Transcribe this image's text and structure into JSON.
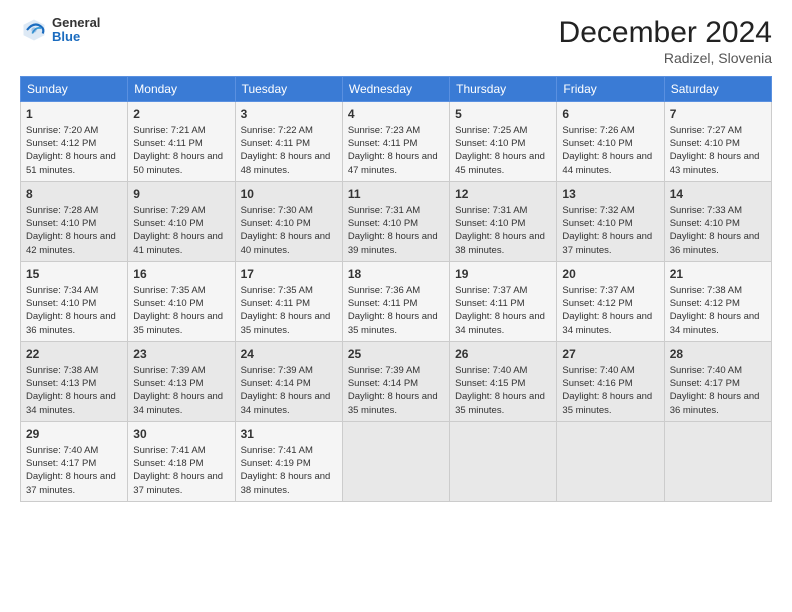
{
  "header": {
    "logo_general": "General",
    "logo_blue": "Blue",
    "title": "December 2024",
    "location": "Radizel, Slovenia"
  },
  "calendar": {
    "days_of_week": [
      "Sunday",
      "Monday",
      "Tuesday",
      "Wednesday",
      "Thursday",
      "Friday",
      "Saturday"
    ],
    "weeks": [
      [
        {
          "day": "",
          "empty": true
        },
        {
          "day": "",
          "empty": true
        },
        {
          "day": "",
          "empty": true
        },
        {
          "day": "",
          "empty": true
        },
        {
          "day": "",
          "empty": true
        },
        {
          "day": "",
          "empty": true
        },
        {
          "day": "",
          "empty": true
        }
      ],
      [
        {
          "day": "1",
          "sunrise": "Sunrise: 7:20 AM",
          "sunset": "Sunset: 4:12 PM",
          "daylight": "Daylight: 8 hours and 51 minutes."
        },
        {
          "day": "2",
          "sunrise": "Sunrise: 7:21 AM",
          "sunset": "Sunset: 4:11 PM",
          "daylight": "Daylight: 8 hours and 50 minutes."
        },
        {
          "day": "3",
          "sunrise": "Sunrise: 7:22 AM",
          "sunset": "Sunset: 4:11 PM",
          "daylight": "Daylight: 8 hours and 48 minutes."
        },
        {
          "day": "4",
          "sunrise": "Sunrise: 7:23 AM",
          "sunset": "Sunset: 4:11 PM",
          "daylight": "Daylight: 8 hours and 47 minutes."
        },
        {
          "day": "5",
          "sunrise": "Sunrise: 7:25 AM",
          "sunset": "Sunset: 4:10 PM",
          "daylight": "Daylight: 8 hours and 45 minutes."
        },
        {
          "day": "6",
          "sunrise": "Sunrise: 7:26 AM",
          "sunset": "Sunset: 4:10 PM",
          "daylight": "Daylight: 8 hours and 44 minutes."
        },
        {
          "day": "7",
          "sunrise": "Sunrise: 7:27 AM",
          "sunset": "Sunset: 4:10 PM",
          "daylight": "Daylight: 8 hours and 43 minutes."
        }
      ],
      [
        {
          "day": "8",
          "sunrise": "Sunrise: 7:28 AM",
          "sunset": "Sunset: 4:10 PM",
          "daylight": "Daylight: 8 hours and 42 minutes."
        },
        {
          "day": "9",
          "sunrise": "Sunrise: 7:29 AM",
          "sunset": "Sunset: 4:10 PM",
          "daylight": "Daylight: 8 hours and 41 minutes."
        },
        {
          "day": "10",
          "sunrise": "Sunrise: 7:30 AM",
          "sunset": "Sunset: 4:10 PM",
          "daylight": "Daylight: 8 hours and 40 minutes."
        },
        {
          "day": "11",
          "sunrise": "Sunrise: 7:31 AM",
          "sunset": "Sunset: 4:10 PM",
          "daylight": "Daylight: 8 hours and 39 minutes."
        },
        {
          "day": "12",
          "sunrise": "Sunrise: 7:31 AM",
          "sunset": "Sunset: 4:10 PM",
          "daylight": "Daylight: 8 hours and 38 minutes."
        },
        {
          "day": "13",
          "sunrise": "Sunrise: 7:32 AM",
          "sunset": "Sunset: 4:10 PM",
          "daylight": "Daylight: 8 hours and 37 minutes."
        },
        {
          "day": "14",
          "sunrise": "Sunrise: 7:33 AM",
          "sunset": "Sunset: 4:10 PM",
          "daylight": "Daylight: 8 hours and 36 minutes."
        }
      ],
      [
        {
          "day": "15",
          "sunrise": "Sunrise: 7:34 AM",
          "sunset": "Sunset: 4:10 PM",
          "daylight": "Daylight: 8 hours and 36 minutes."
        },
        {
          "day": "16",
          "sunrise": "Sunrise: 7:35 AM",
          "sunset": "Sunset: 4:10 PM",
          "daylight": "Daylight: 8 hours and 35 minutes."
        },
        {
          "day": "17",
          "sunrise": "Sunrise: 7:35 AM",
          "sunset": "Sunset: 4:11 PM",
          "daylight": "Daylight: 8 hours and 35 minutes."
        },
        {
          "day": "18",
          "sunrise": "Sunrise: 7:36 AM",
          "sunset": "Sunset: 4:11 PM",
          "daylight": "Daylight: 8 hours and 35 minutes."
        },
        {
          "day": "19",
          "sunrise": "Sunrise: 7:37 AM",
          "sunset": "Sunset: 4:11 PM",
          "daylight": "Daylight: 8 hours and 34 minutes."
        },
        {
          "day": "20",
          "sunrise": "Sunrise: 7:37 AM",
          "sunset": "Sunset: 4:12 PM",
          "daylight": "Daylight: 8 hours and 34 minutes."
        },
        {
          "day": "21",
          "sunrise": "Sunrise: 7:38 AM",
          "sunset": "Sunset: 4:12 PM",
          "daylight": "Daylight: 8 hours and 34 minutes."
        }
      ],
      [
        {
          "day": "22",
          "sunrise": "Sunrise: 7:38 AM",
          "sunset": "Sunset: 4:13 PM",
          "daylight": "Daylight: 8 hours and 34 minutes."
        },
        {
          "day": "23",
          "sunrise": "Sunrise: 7:39 AM",
          "sunset": "Sunset: 4:13 PM",
          "daylight": "Daylight: 8 hours and 34 minutes."
        },
        {
          "day": "24",
          "sunrise": "Sunrise: 7:39 AM",
          "sunset": "Sunset: 4:14 PM",
          "daylight": "Daylight: 8 hours and 34 minutes."
        },
        {
          "day": "25",
          "sunrise": "Sunrise: 7:39 AM",
          "sunset": "Sunset: 4:14 PM",
          "daylight": "Daylight: 8 hours and 35 minutes."
        },
        {
          "day": "26",
          "sunrise": "Sunrise: 7:40 AM",
          "sunset": "Sunset: 4:15 PM",
          "daylight": "Daylight: 8 hours and 35 minutes."
        },
        {
          "day": "27",
          "sunrise": "Sunrise: 7:40 AM",
          "sunset": "Sunset: 4:16 PM",
          "daylight": "Daylight: 8 hours and 35 minutes."
        },
        {
          "day": "28",
          "sunrise": "Sunrise: 7:40 AM",
          "sunset": "Sunset: 4:17 PM",
          "daylight": "Daylight: 8 hours and 36 minutes."
        }
      ],
      [
        {
          "day": "29",
          "sunrise": "Sunrise: 7:40 AM",
          "sunset": "Sunset: 4:17 PM",
          "daylight": "Daylight: 8 hours and 37 minutes."
        },
        {
          "day": "30",
          "sunrise": "Sunrise: 7:41 AM",
          "sunset": "Sunset: 4:18 PM",
          "daylight": "Daylight: 8 hours and 37 minutes."
        },
        {
          "day": "31",
          "sunrise": "Sunrise: 7:41 AM",
          "sunset": "Sunset: 4:19 PM",
          "daylight": "Daylight: 8 hours and 38 minutes."
        },
        {
          "day": "",
          "empty": true
        },
        {
          "day": "",
          "empty": true
        },
        {
          "day": "",
          "empty": true
        },
        {
          "day": "",
          "empty": true
        }
      ]
    ]
  }
}
